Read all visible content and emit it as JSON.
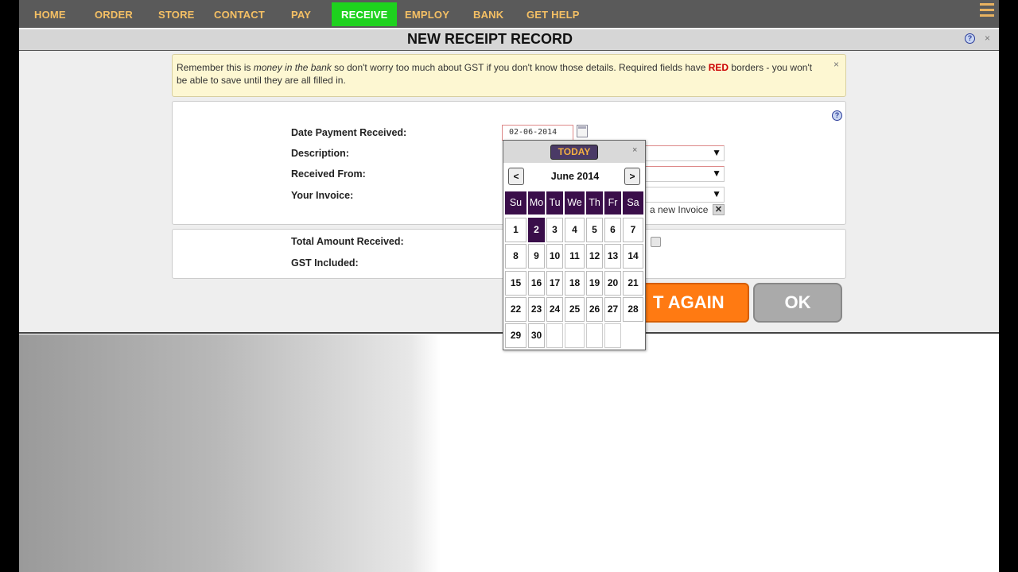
{
  "nav": {
    "items": [
      {
        "label": "HOME"
      },
      {
        "label": "ORDER"
      },
      {
        "label": "STORE"
      },
      {
        "label": "CONTACT"
      },
      {
        "label": "PAY"
      },
      {
        "label": "RECEIVE",
        "active": true
      },
      {
        "label": "EMPLOY"
      },
      {
        "label": "BANK"
      },
      {
        "label": "GET HELP"
      }
    ],
    "menu_icon": "hamburger-icon"
  },
  "title_bar": {
    "title": "NEW RECEIPT RECORD",
    "help_symbol": "?",
    "close_symbol": "×"
  },
  "notice": {
    "text_1": "Remember this is ",
    "text_emph": "money in the bank",
    "text_2": " so don't worry too much about GST if you don't know those details. Required fields have ",
    "text_red": "RED",
    "text_3": " borders - you won't be able to save until they are all filled in.",
    "close_symbol": "×"
  },
  "form": {
    "help_symbol": "?",
    "date_label": "Date Payment Received:",
    "date_value": "02-06-2014",
    "description_label": "Description:",
    "received_from_label": "Received From:",
    "invoice_label": "Your Invoice:",
    "new_invoice_text": "a new Invoice",
    "new_invoice_clear": "✕",
    "dropdown_arrow": "▼",
    "total_label": "Total Amount Received:",
    "gst_label": "GST Included:"
  },
  "buttons": {
    "again_visible_text": "T AGAIN",
    "ok": "OK"
  },
  "datepicker": {
    "today_label": "TODAY",
    "close_symbol": "×",
    "prev": "<",
    "next": ">",
    "month_label": "June 2014",
    "weekdays": [
      "Su",
      "Mo",
      "Tu",
      "We",
      "Th",
      "Fr",
      "Sa"
    ],
    "selected_day": "2",
    "weeks": [
      [
        "1",
        "2",
        "3",
        "4",
        "5",
        "6",
        "7"
      ],
      [
        "8",
        "9",
        "10",
        "11",
        "12",
        "13",
        "14"
      ],
      [
        "15",
        "16",
        "17",
        "18",
        "19",
        "20",
        "21"
      ],
      [
        "22",
        "23",
        "24",
        "25",
        "26",
        "27",
        "28"
      ],
      [
        "29",
        "30",
        "",
        "",
        "",
        "",
        ""
      ]
    ]
  },
  "colors": {
    "nav_bg": "#5a5a5a",
    "nav_text": "#f5c064",
    "nav_active": "#1ed21e",
    "calendar_header": "#3a0e4a",
    "again_button": "#ff7a12",
    "ok_button": "#aaaaaa",
    "required_red": "#cc0000"
  }
}
